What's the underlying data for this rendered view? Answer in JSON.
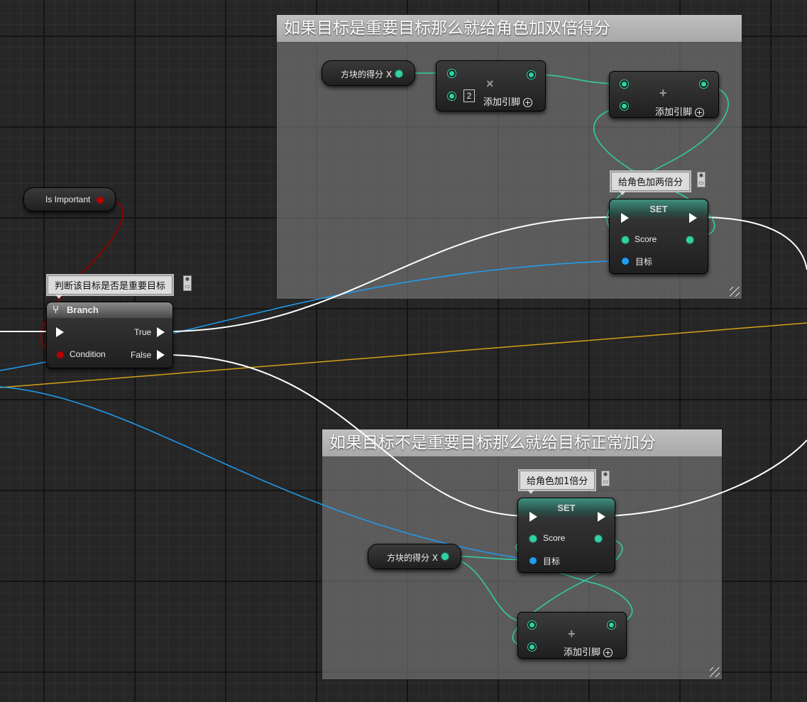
{
  "comments": {
    "important": "如果目标是重要目标那么就给角色加双倍得分",
    "normal": "如果目标不是重要目标那么就给目标正常加分"
  },
  "variables": {
    "is_important": "Is Important",
    "block_score_top": "方块的得分 X",
    "block_score_bottom": "方块的得分 X"
  },
  "multiply_node": {
    "operator": "×",
    "constant": "2",
    "add_pin": "添加引脚"
  },
  "add_node_top": {
    "operator": "+",
    "add_pin": "添加引脚"
  },
  "add_node_bottom": {
    "operator": "+",
    "add_pin": "添加引脚"
  },
  "set_top": {
    "title": "SET",
    "score": "Score",
    "target": "目标",
    "bubble": "给角色加两倍分"
  },
  "set_bottom": {
    "title": "SET",
    "score": "Score",
    "target": "目标",
    "bubble": "给角色加1倍分"
  },
  "branch": {
    "title": "Branch",
    "true_label": "True",
    "false_label": "False",
    "condition": "Condition",
    "bubble": "判断该目标是否是重要目标"
  },
  "colors": {
    "exec_wire": "#ffffff",
    "float_wire": "#2fd2a4",
    "object_wire": "#1e9ef3",
    "bool_wire": "#8b0000",
    "struct_wire": "#d4a017"
  }
}
